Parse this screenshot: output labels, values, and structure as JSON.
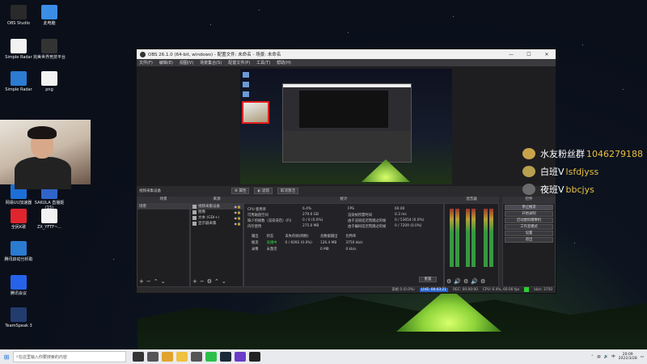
{
  "desktop_icons": [
    {
      "label": "OBS Studio",
      "icon": "obs-icon",
      "color": "#2a2a2a"
    },
    {
      "label": "此电脑",
      "icon": "computer-icon",
      "color": "#3a8ee6"
    },
    {
      "label": "Simple Radar",
      "icon": "file-icon",
      "color": "#f2f2f2"
    },
    {
      "label": "完美世界竞技平台",
      "icon": "app-icon",
      "color": "#333333"
    },
    {
      "label": "Simple Radar",
      "icon": "zip-icon",
      "color": "#2b7bd1"
    },
    {
      "label": "png",
      "icon": "image-icon",
      "color": "#f2f2f2"
    },
    {
      "label": "网易UU加速器",
      "icon": "uu-icon",
      "color": "#1c6fd6"
    },
    {
      "label": "SAKULA 直播姬(15)",
      "icon": "app-icon",
      "color": "#3064c8"
    },
    {
      "label": "全民K歌",
      "icon": "karaoke-icon",
      "color": "#e0262c"
    },
    {
      "label": "ZX_YFTF~...",
      "icon": "file-icon",
      "color": "#f2f2f2"
    },
    {
      "label": "腾讯启动分析助",
      "icon": "zip-icon",
      "color": "#2b7bd1"
    },
    {
      "label": "腾讯会议",
      "icon": "meeting-icon",
      "color": "#2563eb"
    },
    {
      "label": "TeamSpeak 3",
      "icon": "teamspeak-icon",
      "color": "#233c6e"
    }
  ],
  "obs": {
    "window_title": "OBS 26.1.0 (64-bit, windows) - 配置文件: 未命名 - 场景: 未命名",
    "menu": [
      "文件(F)",
      "编辑(E)",
      "视图(V)",
      "场景集合(S)",
      "配置文件(P)",
      "工具(T)",
      "帮助(H)"
    ],
    "source_bar": {
      "selected": "视频采集设备",
      "properties": "属性",
      "filters": "滤镜",
      "deactivate": "取消激活"
    },
    "panel_titles": {
      "scenes": "场景",
      "sources": "来源",
      "stats": "统计",
      "mixer": "混音器",
      "controls": "控件"
    },
    "scenes": [
      "场景"
    ],
    "sources": [
      {
        "name": "视频采集设备",
        "selected": true
      },
      {
        "name": "图像",
        "selected": false
      },
      {
        "name": "文本 (GDI+)",
        "selected": false
      },
      {
        "name": "显示器采集",
        "selected": false
      }
    ],
    "stats": {
      "cpu_label": "CPU 使用率",
      "cpu_value": "6.4%",
      "disk_label": "可用磁盘空间",
      "disk_value": "279.6 GB",
      "render_lag_label": "缺少的帧数（渲染滞后）(FI)",
      "render_lag_value": "0 / 0 (0.0%)",
      "memory_label": "内存使用",
      "memory_value": "275.0 MB",
      "fps_label": "FPS",
      "fps_value": "60.00",
      "frame_time_label": "渲染帧所需时间",
      "frame_time_value": "0.3 ms",
      "encode_lag_label": "由于渲染延迟而跳过的帧",
      "encode_lag_value": "0 / 53654 (0.0%)",
      "encoder_lag_label": "由于编码延迟而跳过的帧",
      "encoder_lag_value": "0 / 7209 (0.0%)",
      "table_headers": [
        "输出",
        "状态",
        "丢失的帧(网络)",
        "总数据输出",
        "比特率"
      ],
      "rows": [
        [
          "推流",
          "直播中",
          "0 / 6092 (0.0%)",
          "126.4 MB",
          "3750 kb/s"
        ],
        [
          "录像",
          "未激活",
          "",
          "0 MB",
          "0 kb/s"
        ]
      ],
      "reset": "重置"
    },
    "controls": [
      "停止推流",
      "开始录制",
      "启动虚拟摄像机",
      "工作室模式",
      "设置",
      "退出"
    ],
    "statusbar": {
      "dropped": "丢帧 0 (0.0%)",
      "live": "LIVE: 00:03:21",
      "rec": "REC: 00:00:00",
      "cpu_fps": "CPU: 6.4%, 60.00 fps",
      "kbps": "kb/s: 3750"
    }
  },
  "chat": [
    {
      "name": "水友粉丝群",
      "msg": "1046279188",
      "badge_color": "#c9a24c"
    },
    {
      "name": "白班V",
      "msg": "lsfdjyss",
      "badge_color": "#b9a050"
    },
    {
      "name": "夜班V",
      "msg": "bbcjys",
      "badge_color": "#6a6a6a"
    }
  ],
  "taskbar": {
    "search_placeholder": "在这里输入你要搜索的内容",
    "time": "20:09",
    "date": "2022/3/28",
    "lang": "中",
    "apps": [
      {
        "icon": "cortana-icon",
        "color": "#333333"
      },
      {
        "icon": "taskview-icon",
        "color": "#555555"
      },
      {
        "icon": "chrome-icon",
        "color": "#e2a32c"
      },
      {
        "icon": "explorer-icon",
        "color": "#f0c040"
      },
      {
        "icon": "store-icon",
        "color": "#555555"
      },
      {
        "icon": "wechat-icon",
        "color": "#2bc04a"
      },
      {
        "icon": "steam-icon",
        "color": "#1b2838"
      },
      {
        "icon": "game-icon",
        "color": "#6a3cc8"
      },
      {
        "icon": "obs-icon",
        "color": "#222222"
      }
    ]
  }
}
